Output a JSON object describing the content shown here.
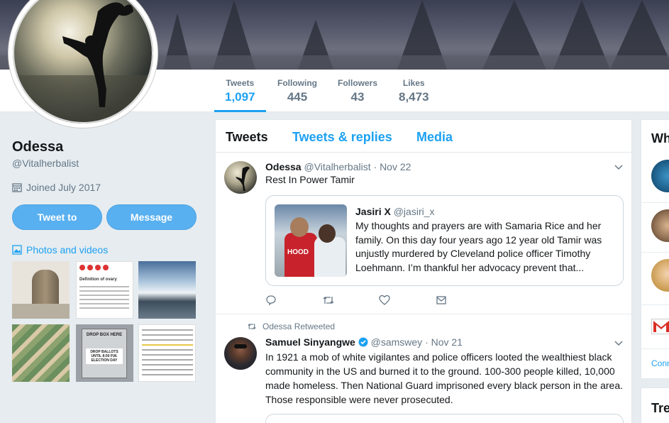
{
  "profile": {
    "name": "Odessa",
    "handle": "@Vitalherbalist",
    "joined": "Joined July 2017",
    "tweet_to_label": "Tweet to",
    "message_label": "Message",
    "photos_label": "Photos and videos"
  },
  "stats": [
    {
      "label": "Tweets",
      "value": "1,097"
    },
    {
      "label": "Following",
      "value": "445"
    },
    {
      "label": "Followers",
      "value": "43"
    },
    {
      "label": "Likes",
      "value": "8,473"
    }
  ],
  "timeline": {
    "tabs": [
      "Tweets",
      "Tweets & replies",
      "Media"
    ],
    "tweet1": {
      "name": "Odessa",
      "handle": "@Vitalherbalist",
      "sep": "·",
      "date": "Nov 22",
      "text": "Rest In Power Tamir",
      "quote": {
        "name": "Jasiri X",
        "handle": "@jasiri_x",
        "text": "My thoughts and prayers are with Samaria Rice and her family. On this day four years ago 12 year old Tamir was unjustly murdered by Cleveland police officer Timothy Loehmann. I’m thankful her advocacy prevent that...",
        "shirt_text": "HOOD"
      }
    },
    "tweet2": {
      "retweet_label": "Odessa Retweeted",
      "name": "Samuel Sinyangwe",
      "handle": "@samswey",
      "sep": "·",
      "date": "Nov 21",
      "text": "In 1921 a mob of white vigilantes and police officers looted the wealthiest black community in the US and burned it to the ground. 100-300 people killed, 10,000 made homeless. Then National Guard imprisoned every black person in the area. Those responsible were never prosecuted."
    }
  },
  "right": {
    "who_title": "Wh",
    "connect_label": "Conn",
    "trends_title": "Tre"
  },
  "thumbs": {
    "doc_title": "Definition of ovary",
    "dropbox_text": "DROP BOX HERE",
    "dropbox_text2": "DROP BALLOTS UNTIL 8:00 P.M. ELECTION DAY"
  },
  "colors": {
    "accent": "#1da1f2",
    "button": "#58b0f0"
  }
}
